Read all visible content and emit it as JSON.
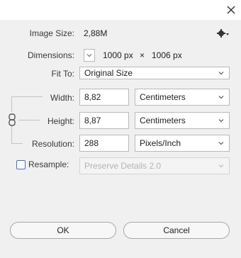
{
  "window": {
    "close_icon": "close-icon"
  },
  "image_size": {
    "label": "Image Size:",
    "value": "2,88M"
  },
  "settings_icon": "gear-icon",
  "dimensions": {
    "label": "Dimensions:",
    "width": "1000 px",
    "times": "×",
    "height": "1006 px"
  },
  "fit_to": {
    "label": "Fit To:",
    "selected": "Original Size"
  },
  "width": {
    "label": "Width:",
    "value": "8,82",
    "unit": "Centimeters"
  },
  "height": {
    "label": "Height:",
    "value": "8,87",
    "unit": "Centimeters"
  },
  "resolution": {
    "label": "Resolution:",
    "value": "288",
    "unit": "Pixels/Inch"
  },
  "resample": {
    "label": "Resample:",
    "checked": false,
    "method": "Preserve Details 2.0"
  },
  "buttons": {
    "ok": "OK",
    "cancel": "Cancel"
  },
  "colors": {
    "accent": "#3a74c9",
    "background": "#f0f0f0"
  }
}
